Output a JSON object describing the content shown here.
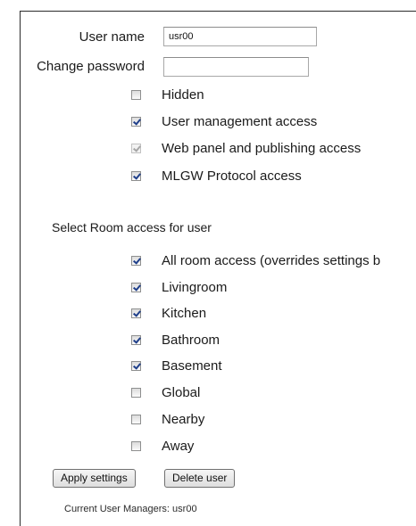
{
  "form": {
    "username_label": "User name",
    "username_value": "usr00",
    "password_label": "Change password",
    "password_value": ""
  },
  "permissions": [
    {
      "label": "Hidden",
      "checked": false,
      "disabled": false
    },
    {
      "label": "User management access",
      "checked": true,
      "disabled": false
    },
    {
      "label": "Web panel and publishing access",
      "checked": true,
      "disabled": true
    },
    {
      "label": "MLGW Protocol access",
      "checked": true,
      "disabled": false
    }
  ],
  "rooms": {
    "heading": "Select Room access for user",
    "items": [
      {
        "label": "All room access (overrides settings b",
        "checked": true
      },
      {
        "label": "Livingroom",
        "checked": true
      },
      {
        "label": "Kitchen",
        "checked": true
      },
      {
        "label": "Bathroom",
        "checked": true
      },
      {
        "label": "Basement",
        "checked": true
      },
      {
        "label": "Global",
        "checked": false
      },
      {
        "label": "Nearby",
        "checked": false
      },
      {
        "label": "Away",
        "checked": false
      }
    ]
  },
  "buttons": {
    "apply": "Apply settings",
    "delete": "Delete user"
  },
  "footer": {
    "managers": "Current User Managers: usr00"
  }
}
